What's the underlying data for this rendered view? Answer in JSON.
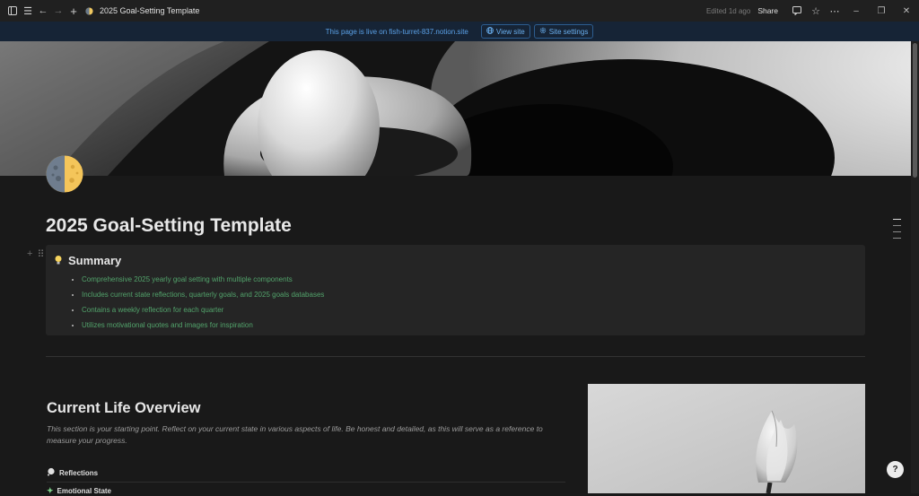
{
  "topbar": {
    "title": "2025 Goal-Setting Template",
    "edited": "Edited 1d ago",
    "share_label": "Share"
  },
  "banner": {
    "message": "This page is live on fish-turret-837.notion.site",
    "view_site_label": "View site",
    "site_settings_label": "Site settings"
  },
  "page": {
    "title": "2025 Goal-Setting Template"
  },
  "summary": {
    "heading": "Summary",
    "items": [
      "Comprehensive 2025 yearly goal setting with multiple components",
      "Includes current state reflections, quarterly goals, and 2025 goals databases",
      "Contains a weekly reflection for each quarter",
      "Utilizes motivational quotes and images for inspiration"
    ]
  },
  "overview": {
    "heading": "Current Life Overview",
    "description": "This section is your starting point. Reflect on your current state in various aspects of life. Be honest and detailed, as this will serve as a reference to measure your progress.",
    "rows": [
      "Reflections",
      "Emotional State"
    ]
  },
  "help_label": "?",
  "colors": {
    "background": "#191919",
    "banner_bg": "#162436",
    "link_blue": "#5aa0e6",
    "bullet_green": "#52a36b"
  }
}
